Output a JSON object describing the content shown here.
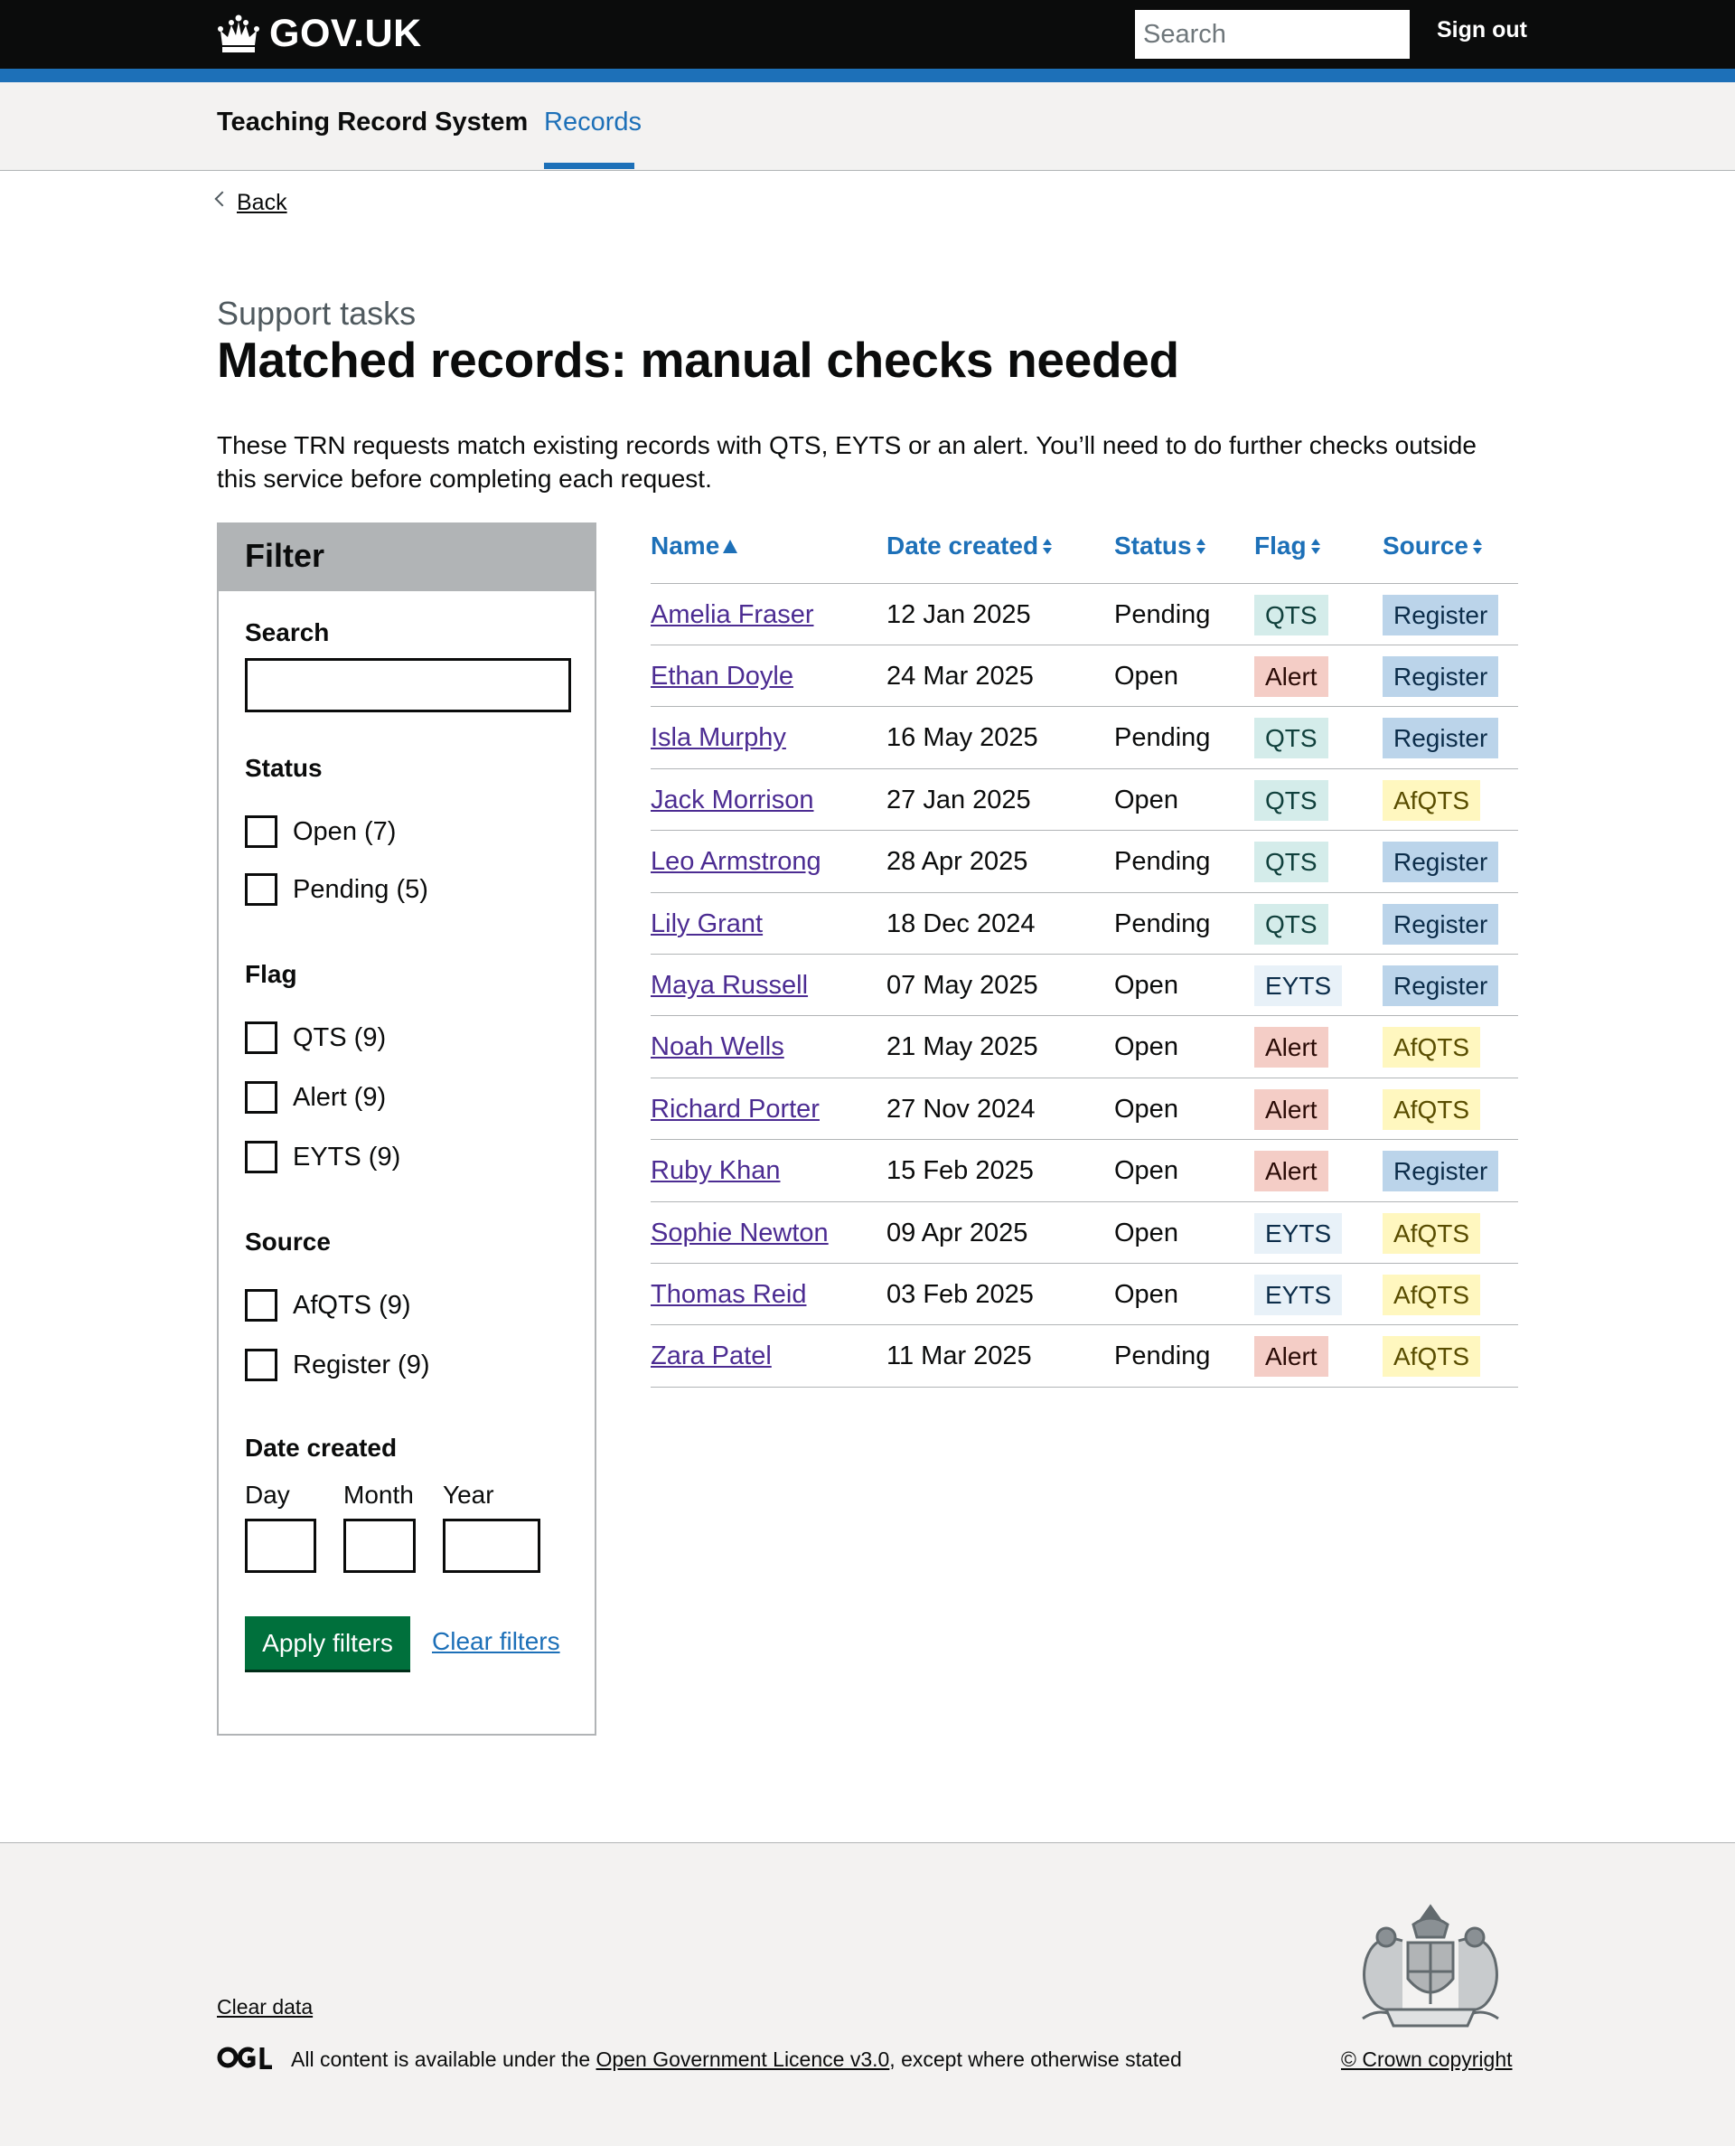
{
  "header": {
    "logo_text": "GOV.UK",
    "search_placeholder": "Search",
    "signout_label": "Sign out"
  },
  "service_nav": {
    "service_name": "Teaching Record System",
    "records_label": "Records"
  },
  "back_label": "Back",
  "caption": "Support tasks",
  "title": "Matched records: manual checks needed",
  "intro": "These TRN requests match existing records with QTS, EYTS or an alert. You’ll need to do further checks outside this service before completing each request.",
  "filter": {
    "title": "Filter",
    "search_label": "Search",
    "status_label": "Status",
    "status_options": [
      "Open (7)",
      "Pending (5)"
    ],
    "flag_label": "Flag",
    "flag_options": [
      "QTS (9)",
      "Alert (9)",
      "EYTS (9)"
    ],
    "source_label": "Source",
    "source_options": [
      "AfQTS (9)",
      "Register (9)"
    ],
    "date_label": "Date created",
    "day_label": "Day",
    "month_label": "Month",
    "year_label": "Year",
    "apply_label": "Apply filters",
    "clear_label": "Clear filters"
  },
  "table": {
    "headers": {
      "name": "Name",
      "date": "Date created",
      "status": "Status",
      "flag": "Flag",
      "source": "Source"
    },
    "rows": [
      {
        "name": "Amelia Fraser",
        "date": "12 Jan 2025",
        "status": "Pending",
        "flag": "QTS",
        "source": "Register"
      },
      {
        "name": "Ethan Doyle",
        "date": "24 Mar 2025",
        "status": "Open",
        "flag": "Alert",
        "source": "Register"
      },
      {
        "name": "Isla Murphy",
        "date": "16 May 2025",
        "status": "Pending",
        "flag": "QTS",
        "source": "Register"
      },
      {
        "name": "Jack Morrison",
        "date": "27 Jan 2025",
        "status": "Open",
        "flag": "QTS",
        "source": "AfQTS"
      },
      {
        "name": "Leo Armstrong",
        "date": "28 Apr 2025",
        "status": "Pending",
        "flag": "QTS",
        "source": "Register"
      },
      {
        "name": "Lily Grant",
        "date": "18 Dec 2024",
        "status": "Pending",
        "flag": "QTS",
        "source": "Register"
      },
      {
        "name": "Maya Russell",
        "date": "07 May 2025",
        "status": "Open",
        "flag": "EYTS",
        "source": "Register"
      },
      {
        "name": "Noah Wells",
        "date": "21 May 2025",
        "status": "Open",
        "flag": "Alert",
        "source": "AfQTS"
      },
      {
        "name": "Richard Porter",
        "date": "27 Nov 2024",
        "status": "Open",
        "flag": "Alert",
        "source": "AfQTS"
      },
      {
        "name": "Ruby Khan",
        "date": "15 Feb 2025",
        "status": "Open",
        "flag": "Alert",
        "source": "Register"
      },
      {
        "name": "Sophie Newton",
        "date": "09 Apr 2025",
        "status": "Open",
        "flag": "EYTS",
        "source": "AfQTS"
      },
      {
        "name": "Thomas Reid",
        "date": "03 Feb 2025",
        "status": "Open",
        "flag": "EYTS",
        "source": "AfQTS"
      },
      {
        "name": "Zara Patel",
        "date": "11 Mar 2025",
        "status": "Pending",
        "flag": "Alert",
        "source": "AfQTS"
      }
    ]
  },
  "footer": {
    "clear_data": "Clear data",
    "licence_prefix": "All content is available under the ",
    "licence_link": "Open Government Licence v3.0",
    "licence_suffix": ", except where otherwise stated",
    "copyright": "© Crown copyright"
  },
  "colors": {
    "header_bg": "#0b0c0c",
    "brand_blue": "#1d70b8",
    "link_visited": "#4c2c92",
    "button_green": "#00703c",
    "panel_grey": "#b1b4b6",
    "footer_bg": "#f3f2f1"
  }
}
